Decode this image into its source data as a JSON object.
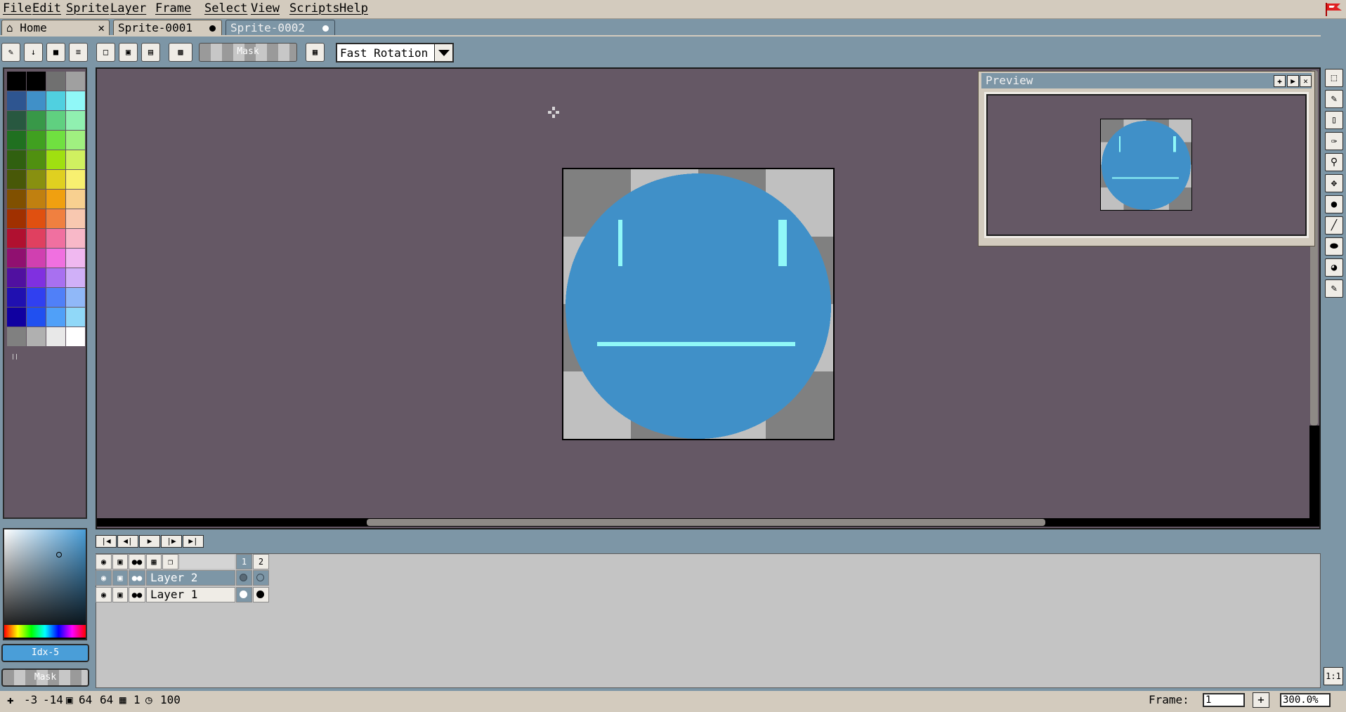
{
  "menu": {
    "items": [
      "File",
      "Edit",
      "Sprite",
      "Layer",
      "Frame",
      "Select",
      "View",
      "Scripts",
      "Help"
    ]
  },
  "tabs": [
    {
      "label": "Home",
      "closable": true
    },
    {
      "label": "Sprite-0001",
      "modified": true
    },
    {
      "label": "Sprite-0002",
      "modified": true,
      "active": true
    }
  ],
  "toolbar": {
    "mask_label": "Mask",
    "rotation_algorithm": "Fast Rotation"
  },
  "palette": {
    "colors": [
      "#000000",
      "#000000",
      "#707070",
      "#a0a0a0",
      "#2e5590",
      "#4090c8",
      "#50d0e0",
      "#90f8f8",
      "#285840",
      "#389848",
      "#60d080",
      "#90f0b0",
      "#207020",
      "#40a020",
      "#70e040",
      "#a0f080",
      "#306010",
      "#509010",
      "#a0e010",
      "#d0f060",
      "#485808",
      "#889010",
      "#e0d020",
      "#f8f070",
      "#805000",
      "#c08010",
      "#f0a010",
      "#f8d090",
      "#a03000",
      "#e05010",
      "#f08040",
      "#f8c8b0",
      "#b01030",
      "#e04060",
      "#f070a0",
      "#f8b8c8",
      "#901070",
      "#d040b0",
      "#f070e0",
      "#f0b8f0",
      "#5010a0",
      "#8030e0",
      "#a870f0",
      "#d0b0f8",
      "#2010b0",
      "#3040f0",
      "#5080f8",
      "#90b8f8",
      "#1000a0",
      "#2050f0",
      "#50a0f8",
      "#90d8f8",
      "#808080",
      "#b0b0b0",
      "#e8e8e8",
      "#ffffff"
    ]
  },
  "color_bar": {
    "index_label": "Idx-5",
    "mask_label": "Mask",
    "fg_color": "#4090c8"
  },
  "preview": {
    "title": "Preview"
  },
  "sprite": {
    "face_color": "#4090c8",
    "feature_color": "#90f8f8",
    "checker_dark": "#808080",
    "checker_light": "#c0c0c0"
  },
  "timeline": {
    "frames": [
      "1",
      "2"
    ],
    "layers": [
      {
        "name": "Layer 2",
        "selected": true
      },
      {
        "name": "Layer 1",
        "selected": false
      }
    ]
  },
  "status": {
    "pos_x": "-3",
    "pos_y": "-14",
    "width": "64",
    "height": "64",
    "frame": "1",
    "duration": "100",
    "frame_label": "Frame:",
    "frame_value": "1",
    "zoom": "300.0%",
    "one_to_one": "1:1"
  }
}
